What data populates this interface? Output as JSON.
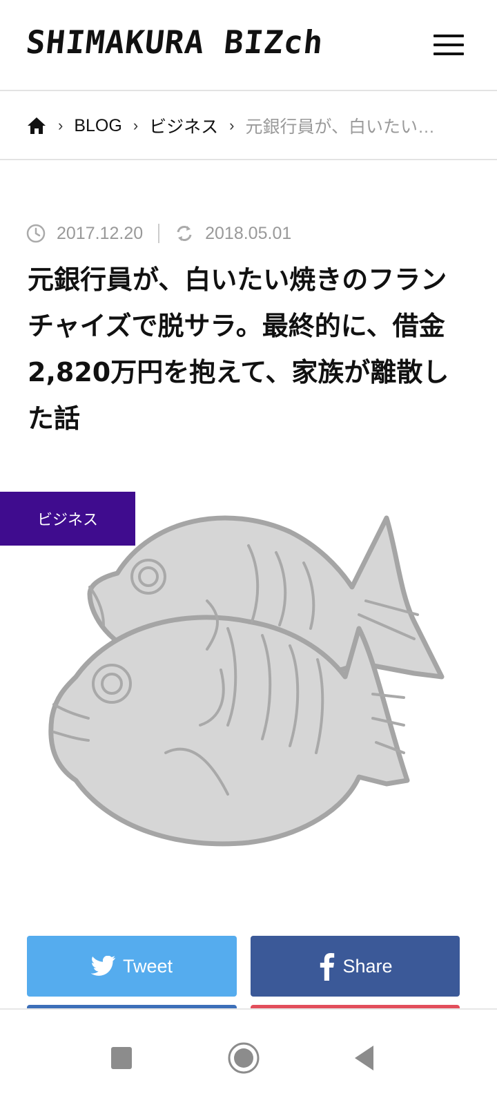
{
  "header": {
    "logo_text": "SHIMAKURA BIZch",
    "menu_icon": "hamburger-menu-icon"
  },
  "breadcrumb": {
    "home_icon": "home-icon",
    "items": [
      "BLOG",
      "ビジネス"
    ],
    "current": "元銀行員が、白いたい焼…"
  },
  "meta": {
    "published": "2017.12.20",
    "updated": "2018.05.01"
  },
  "article": {
    "title_part1": "元銀行員が、白いたい焼きのフランチャイズで脱サラ。最終的に、借金",
    "title_amount": "2,820",
    "title_part2": "万円を抱えて、家族が離散した話",
    "category": "ビジネス",
    "image": "taiyaki-illustration"
  },
  "share": {
    "tweet_label": "Tweet",
    "share_label": "Share"
  },
  "colors": {
    "category_badge": "#3f0c8e",
    "twitter": "#55acee",
    "facebook": "#3b5998",
    "meta_text": "#999999"
  }
}
